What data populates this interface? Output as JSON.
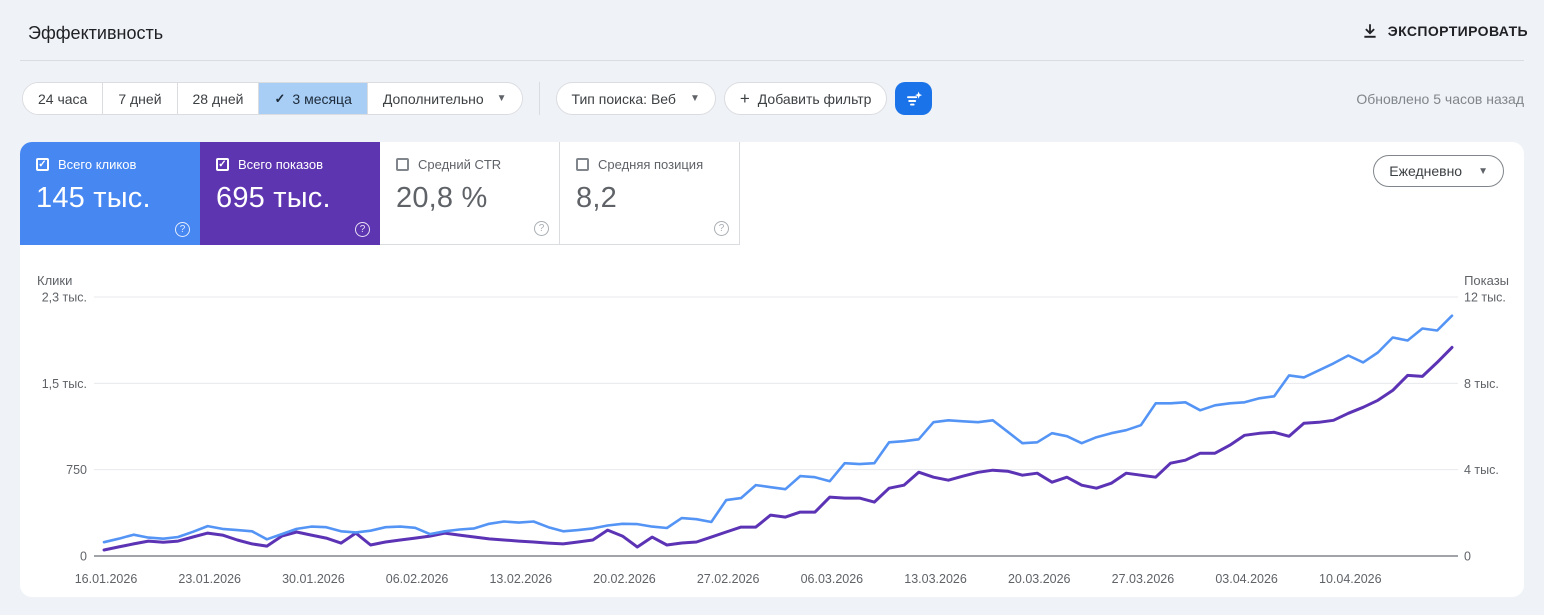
{
  "header": {
    "title": "Эффективность",
    "export_label": "ЭКСПОРТИРОВАТЬ"
  },
  "toolbar": {
    "ranges": [
      "24 часа",
      "7 дней",
      "28 дней",
      "3 месяца"
    ],
    "selected_range": "3 месяца",
    "more_label": "Дополнительно",
    "search_type_label": "Тип поиска: Веб",
    "add_filter_label": "Добавить фильтр",
    "updated_label": "Обновлено 5 часов назад"
  },
  "metrics": {
    "cards": [
      {
        "label": "Всего кликов",
        "value": "145 тыс.",
        "checked": true,
        "color": "#4687f2"
      },
      {
        "label": "Всего показов",
        "value": "695 тыс.",
        "checked": true,
        "color": "#5e35b1"
      },
      {
        "label": "Средний CTR",
        "value": "20,8 %",
        "checked": false,
        "color": "#ffffff"
      },
      {
        "label": "Средняя позиция",
        "value": "8,2",
        "checked": false,
        "color": "#ffffff"
      }
    ],
    "granularity_label": "Ежедневно"
  },
  "chart_data": {
    "type": "line",
    "grid": true,
    "legend_position": "none",
    "left_axis": {
      "title": "Клики",
      "max": 2250,
      "ticks_bottom_to_top": [
        "0",
        "750",
        "1,5 тыс.",
        "2,3 тыс."
      ]
    },
    "right_axis": {
      "title": "Показы",
      "max": 12000,
      "ticks_bottom_to_top": [
        "0",
        "4 тыс.",
        "8 тыс.",
        "12 тыс."
      ]
    },
    "x_tick_labels": [
      "16.01.2026",
      "23.01.2026",
      "30.01.2026",
      "06.02.2026",
      "13.02.2026",
      "20.02.2026",
      "27.02.2026",
      "06.03.2026",
      "13.03.2026",
      "20.03.2026",
      "27.03.2026",
      "03.04.2026",
      "10.04.2026"
    ],
    "series": [
      {
        "name": "Клики",
        "axis": "left",
        "color": "#5494f5",
        "width": 2.6,
        "values": [
          120,
          150,
          185,
          160,
          150,
          165,
          210,
          260,
          235,
          225,
          215,
          145,
          190,
          235,
          255,
          250,
          215,
          205,
          220,
          250,
          255,
          245,
          190,
          215,
          230,
          240,
          280,
          300,
          290,
          300,
          250,
          215,
          225,
          240,
          265,
          280,
          277,
          255,
          243,
          329,
          320,
          295,
          486,
          503,
          616,
          598,
          580,
          694,
          685,
          650,
          806,
          798,
          806,
          988,
          997,
          1014,
          1162,
          1179,
          1170,
          1162,
          1179,
          1080,
          980,
          988,
          1067,
          1041,
          980,
          1032,
          1067,
          1093,
          1136,
          1327,
          1327,
          1335,
          1266,
          1309,
          1327,
          1335,
          1370,
          1387,
          1569,
          1552,
          1612,
          1673,
          1742,
          1682,
          1768,
          1898,
          1872,
          1976,
          1959,
          2088
        ]
      },
      {
        "name": "Показы",
        "axis": "right",
        "color": "#5c33b5",
        "width": 3,
        "values": [
          277,
          420,
          560,
          690,
          640,
          690,
          880,
          1060,
          970,
          740,
          560,
          460,
          920,
          1110,
          970,
          830,
          600,
          1060,
          510,
          650,
          740,
          830,
          920,
          1060,
          970,
          880,
          790,
          740,
          690,
          650,
          600,
          560,
          650,
          740,
          1200,
          920,
          416,
          878,
          509,
          601,
          647,
          878,
          1110,
          1341,
          1341,
          1895,
          1803,
          2034,
          2034,
          2728,
          2681,
          2681,
          2496,
          3143,
          3282,
          3883,
          3652,
          3513,
          3700,
          3880,
          3975,
          3929,
          3744,
          3837,
          3421,
          3652,
          3282,
          3143,
          3375,
          3837,
          3744,
          3652,
          4300,
          4439,
          4762,
          4762,
          5132,
          5594,
          5687,
          5733,
          5548,
          6149,
          6195,
          6288,
          6611,
          6889,
          7212,
          7675,
          8368,
          8322,
          8970,
          9664
        ]
      }
    ]
  },
  "colors": {
    "accent_blue": "#1a73e8",
    "selected_tab_bg": "#a9cef6",
    "grid_line": "#e8eaed",
    "zero_line": "#80868b",
    "tick_text": "#5f6368"
  }
}
